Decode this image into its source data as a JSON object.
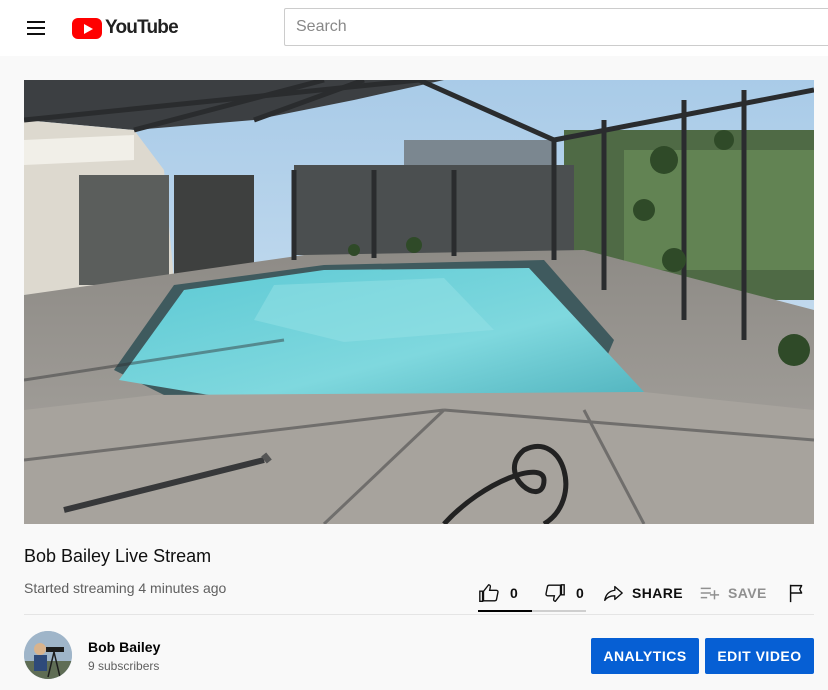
{
  "header": {
    "logo_text": "YouTube",
    "search_placeholder": "Search"
  },
  "video": {
    "title": "Bob Bailey Live Stream",
    "meta": "Started streaming 4 minutes ago",
    "like_count": "0",
    "dislike_count": "0",
    "share_label": "SHARE",
    "save_label": "SAVE"
  },
  "channel": {
    "name": "Bob Bailey",
    "subscribers": "9 subscribers"
  },
  "buttons": {
    "analytics": "ANALYTICS",
    "edit_video": "EDIT VIDEO"
  },
  "icons": {
    "menu": "hamburger-menu-icon",
    "like": "thumbs-up-icon",
    "dislike": "thumbs-down-icon",
    "share": "share-arrow-icon",
    "save": "playlist-add-icon",
    "report": "flag-icon"
  },
  "colors": {
    "brand_red": "#ff0000",
    "accent_blue": "#065fd4"
  }
}
